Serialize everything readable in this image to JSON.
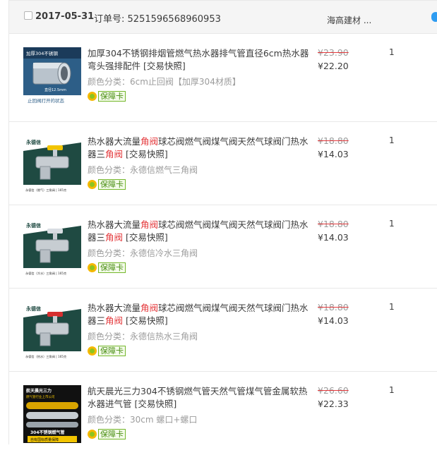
{
  "order": {
    "date": "2017-05-31",
    "order_no_label": "订单号:",
    "order_no": "5251596568960953",
    "shop_name": "海高建材 ..."
  },
  "items": [
    {
      "title": "加厚304不锈钢排烟管燃气热水器排气管直径6cm热水器弯头强排配件",
      "title_red": "",
      "title_tail": "",
      "snapshot": "[交易快照]",
      "sku": "颜色分类：6cm止回阀【加厚304材质】",
      "guarantee": "保障卡",
      "old_price": "¥23.90",
      "new_price": "¥22.20",
      "qty": "1",
      "thumb_label": "止回阀打开的状态",
      "thumb_top": "加厚304不锈钢",
      "thumb_dim": "直径12.5mm"
    },
    {
      "title": "热水器大流量",
      "title_red": "角阀",
      "title_tail": "球芯阀燃气阀煤气阀天然气球阀门热水器三",
      "title_red2": "角阀",
      "snapshot": "[交易快照]",
      "sku": "颜色分类：永德信燃气三角阀",
      "guarantee": "保障卡",
      "old_price": "¥18.80",
      "new_price": "¥14.03",
      "qty": "1",
      "thumb_brand": "永德信",
      "thumb_caption": "永德信（燃气）三角阀 | 165克"
    },
    {
      "title": "热水器大流量",
      "title_red": "角阀",
      "title_tail": "球芯阀燃气阀煤气阀天然气球阀门热水器三",
      "title_red2": "角阀",
      "snapshot": "[交易快照]",
      "sku": "颜色分类：永德信冷水三角阀",
      "guarantee": "保障卡",
      "old_price": "¥18.80",
      "new_price": "¥14.03",
      "qty": "1",
      "thumb_brand": "永德信",
      "thumb_caption": "永德信（冷水）三角阀 | 165克"
    },
    {
      "title": "热水器大流量",
      "title_red": "角阀",
      "title_tail": "球芯阀燃气阀煤气阀天然气球阀门热水器三",
      "title_red2": "角阀",
      "snapshot": "[交易快照]",
      "sku": "颜色分类：永德信热水三角阀",
      "guarantee": "保障卡",
      "old_price": "¥18.80",
      "new_price": "¥14.03",
      "qty": "1",
      "thumb_brand": "永德信",
      "thumb_caption": "永德信（热水）三角阀 | 165克"
    },
    {
      "title": "航天晨光三力304不锈钢燃气管天然气管煤气管金属软热水器进气管",
      "title_red": "",
      "title_tail": "",
      "snapshot": "[交易快照]",
      "sku": "颜色分类：30cm 螺口+螺口",
      "guarantee": "保障卡",
      "old_price": "¥26.60",
      "new_price": "¥22.33",
      "qty": "1",
      "thumb_brand": "航天晨光三力",
      "thumb_sub": "燃气管行业上市公司",
      "thumb_caption": "304不锈钢燃气管",
      "thumb_caption2": "自有国标质量保障"
    }
  ]
}
